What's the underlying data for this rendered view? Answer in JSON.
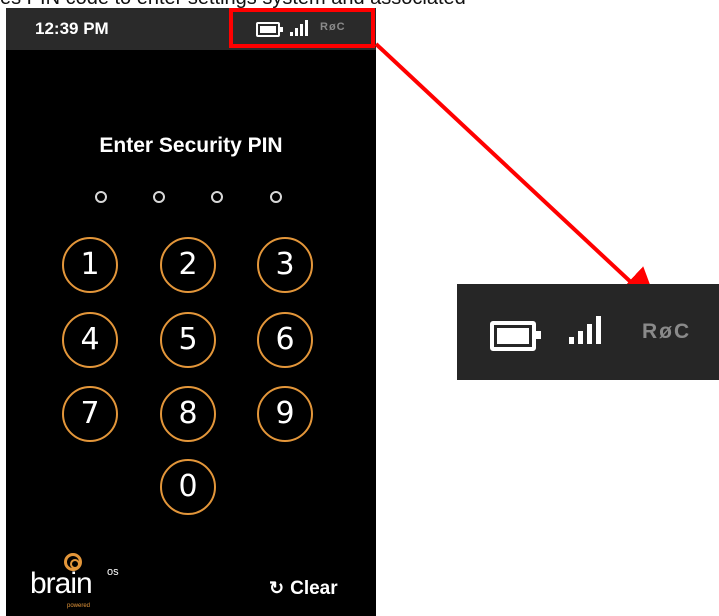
{
  "caption": "es PIN code to enter settings system and associated",
  "status_bar": {
    "time": "12:39 PM",
    "icons": [
      "battery-icon",
      "signal-icon",
      "roc-icon"
    ],
    "roc_label": "RøC"
  },
  "pin_screen": {
    "title": "Enter Security PIN",
    "pin_length": 4,
    "keys": [
      "1",
      "2",
      "3",
      "4",
      "5",
      "6",
      "7",
      "8",
      "9",
      "0"
    ],
    "clear_label": "Clear"
  },
  "logo": {
    "text": "brain",
    "superscript": "os",
    "tagline": "powered"
  },
  "zoom_inset": {
    "roc_label": "RøC"
  },
  "colors": {
    "accent": "#e3963a",
    "highlight": "#ff0000",
    "background": "#000000",
    "status_bar": "#2a2a2a"
  }
}
